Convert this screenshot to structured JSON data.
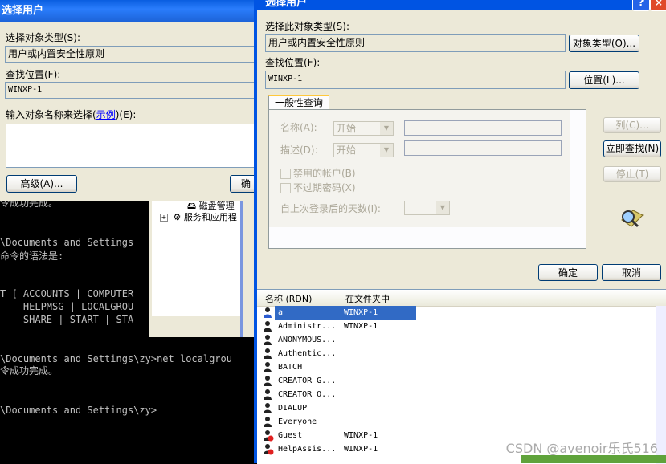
{
  "console": {
    "lines": [
      "令成功完成。",
      "\\Documents and Settings",
      "命令的语法是:",
      "T [ ACCOUNTS | COMPUTER",
      "    HELPMSG | LOCALGROU",
      "    SHARE | START | STA",
      "\\Documents and Settings\\zy>net localgrou",
      "令成功完成。",
      "\\Documents and Settings\\zy>"
    ]
  },
  "explorer": {
    "item1": "磁盘管理",
    "item2": "服务和应用程"
  },
  "left_dialog": {
    "title": "选择用户",
    "obj_type_label": "选择对象类型(S):",
    "obj_type_value": "用户或内置安全性原则",
    "location_label": "查找位置(F):",
    "location_value": "WINXP-1",
    "enter_label_pre": "输入对象名称来选择(",
    "enter_label_link": "示例",
    "enter_label_post": ")(E):",
    "advanced_button": "高级(A)...",
    "ok_partial": "确"
  },
  "right_dialog": {
    "title": "选择用户",
    "help": "?",
    "close": "×",
    "obj_type_label": "选择此对象类型(S):",
    "obj_type_value": "用户或内置安全性原则",
    "obj_type_button": "对象类型(O)...",
    "location_label": "查找位置(F):",
    "location_value": "WINXP-1",
    "location_button": "位置(L)...",
    "tab_label": "一般性查询",
    "name_label": "名称(A):",
    "name_combo": "开始",
    "desc_label": "描述(D):",
    "desc_combo": "开始",
    "disabled_accounts": "禁用的帐户(B)",
    "no_expire": "不过期密码(X)",
    "days_label": "自上次登录后的天数(I):",
    "columns_button": "列(C)...",
    "find_now_button": "立即查找(N)",
    "stop_button": "停止(T)",
    "ok_button": "确定",
    "cancel_button": "取消"
  },
  "results": {
    "col_name": "名称 (RDN)",
    "col_folder": "在文件夹中",
    "rows": [
      {
        "name": "a",
        "folder": "WINXP-1"
      },
      {
        "name": "Administr...",
        "folder": "WINXP-1"
      },
      {
        "name": "ANONYMOUS...",
        "folder": ""
      },
      {
        "name": "Authentic...",
        "folder": ""
      },
      {
        "name": "BATCH",
        "folder": ""
      },
      {
        "name": "CREATOR G...",
        "folder": ""
      },
      {
        "name": "CREATOR O...",
        "folder": ""
      },
      {
        "name": "DIALUP",
        "folder": ""
      },
      {
        "name": "Everyone",
        "folder": ""
      },
      {
        "name": "Guest",
        "folder": "WINXP-1"
      },
      {
        "name": "HelpAssis...",
        "folder": "WINXP-1"
      }
    ]
  },
  "watermark": "CSDN @avenoir乐氏516",
  "colors": {
    "title_blue": "#0054e3",
    "dialog_bg": "#ece9d8",
    "selection": "#316ac5"
  }
}
